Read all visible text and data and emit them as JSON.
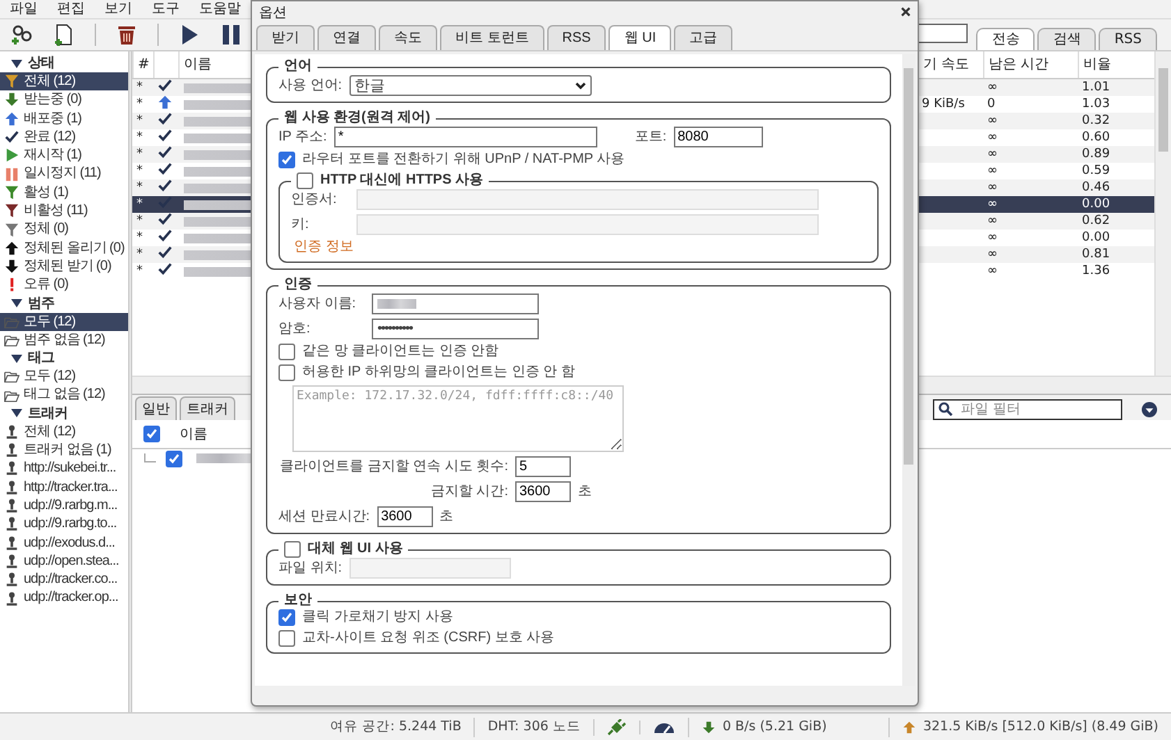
{
  "menu": [
    "파일",
    "편집",
    "보기",
    "도구",
    "도움말"
  ],
  "main_tabs": [
    {
      "label": "전송",
      "selected": true
    },
    {
      "label": "검색",
      "selected": false
    },
    {
      "label": "RSS",
      "selected": false
    }
  ],
  "sidebar": {
    "sections": [
      {
        "title": "상태",
        "expanded": true,
        "items": [
          {
            "label": "전체 (12)",
            "kind": "all",
            "selected": true
          },
          {
            "label": "받는중 (0)",
            "kind": "downloading",
            "selected": false
          },
          {
            "label": "배포중 (1)",
            "kind": "seeding",
            "selected": false
          },
          {
            "label": "완료 (12)",
            "kind": "completed",
            "selected": false
          },
          {
            "label": "재시작 (1)",
            "kind": "resumed",
            "selected": false
          },
          {
            "label": "일시정지 (11)",
            "kind": "paused",
            "selected": false
          },
          {
            "label": "활성 (1)",
            "kind": "active",
            "selected": false
          },
          {
            "label": "비활성 (11)",
            "kind": "inactive",
            "selected": false
          },
          {
            "label": "정체 (0)",
            "kind": "stalled",
            "selected": false
          },
          {
            "label": "정체된 올리기 (0)",
            "kind": "stalled_up",
            "selected": false
          },
          {
            "label": "정체된 받기 (0)",
            "kind": "stalled_down",
            "selected": false
          },
          {
            "label": "오류 (0)",
            "kind": "errored",
            "selected": false
          }
        ]
      },
      {
        "title": "범주",
        "expanded": true,
        "items": [
          {
            "label": "모두 (12)",
            "kind": "folder",
            "selected": true
          },
          {
            "label": "범주 없음 (12)",
            "kind": "folder",
            "selected": false
          }
        ]
      },
      {
        "title": "태그",
        "expanded": true,
        "items": [
          {
            "label": "모두 (12)",
            "kind": "folder",
            "selected": false
          },
          {
            "label": "태그 없음 (12)",
            "kind": "folder",
            "selected": false
          }
        ]
      },
      {
        "title": "트래커",
        "expanded": true,
        "items": [
          {
            "label": "전체 (12)",
            "kind": "tracker",
            "selected": false
          },
          {
            "label": "트래커 없음 (1)",
            "kind": "tracker",
            "selected": false
          },
          {
            "label": "http://sukebei.tr...",
            "kind": "tracker",
            "selected": false
          },
          {
            "label": "http://tracker.tra...",
            "kind": "tracker",
            "selected": false
          },
          {
            "label": "udp://9.rarbg.m...",
            "kind": "tracker",
            "selected": false
          },
          {
            "label": "udp://9.rarbg.to...",
            "kind": "tracker",
            "selected": false
          },
          {
            "label": "udp://exodus.d...",
            "kind": "tracker",
            "selected": false
          },
          {
            "label": "udp://open.stea...",
            "kind": "tracker",
            "selected": false
          },
          {
            "label": "udp://tracker.co...",
            "kind": "tracker",
            "selected": false
          },
          {
            "label": "udp://tracker.op...",
            "kind": "tracker",
            "selected": false
          }
        ]
      }
    ]
  },
  "torrents": {
    "columns": [
      "#",
      "이름",
      "기 속도",
      "남은 시간",
      "비율"
    ],
    "rows": [
      {
        "num": "*",
        "kind": "completed",
        "eta": "∞",
        "ratio": "1.01",
        "selected": false
      },
      {
        "num": "*",
        "kind": "seeding",
        "speed": "9 KiB/s",
        "eta": "0",
        "ratio": "1.03",
        "selected": false
      },
      {
        "num": "*",
        "kind": "completed",
        "eta": "∞",
        "ratio": "0.32",
        "selected": false
      },
      {
        "num": "*",
        "kind": "completed",
        "eta": "∞",
        "ratio": "0.60",
        "selected": false
      },
      {
        "num": "*",
        "kind": "completed",
        "eta": "∞",
        "ratio": "0.89",
        "selected": false
      },
      {
        "num": "*",
        "kind": "completed",
        "eta": "∞",
        "ratio": "0.59",
        "selected": false
      },
      {
        "num": "*",
        "kind": "completed",
        "eta": "∞",
        "ratio": "0.46",
        "selected": false
      },
      {
        "num": "*",
        "kind": "completed",
        "eta": "∞",
        "ratio": "0.00",
        "selected": true
      },
      {
        "num": "*",
        "kind": "completed",
        "eta": "∞",
        "ratio": "0.62",
        "selected": false
      },
      {
        "num": "*",
        "kind": "completed",
        "eta": "∞",
        "ratio": "0.00",
        "selected": false
      },
      {
        "num": "*",
        "kind": "completed",
        "eta": "∞",
        "ratio": "0.81",
        "selected": false
      },
      {
        "num": "*",
        "kind": "completed",
        "eta": "∞",
        "ratio": "1.36",
        "selected": false
      }
    ]
  },
  "details": {
    "tabs": [
      {
        "label": "일반",
        "selected": false
      },
      {
        "label": "트래커",
        "selected": false
      }
    ],
    "filter_placeholder": "파일 필터",
    "files": {
      "column": "이름",
      "header_checked": true,
      "rows": [
        {
          "checked": true
        }
      ]
    }
  },
  "status_bar": {
    "free_space": "여유 공간: 5.244 TiB",
    "dht": "DHT: 306 노드",
    "download": "0 B/s (5.21 GiB)",
    "upload": "321.5 KiB/s [512.0 KiB/s] (8.49 GiB)"
  },
  "dialog": {
    "title": "옵션",
    "tabs": [
      {
        "label": "받기",
        "selected": false
      },
      {
        "label": "연결",
        "selected": false
      },
      {
        "label": "속도",
        "selected": false
      },
      {
        "label": "비트 토런트",
        "selected": false
      },
      {
        "label": "RSS",
        "selected": false
      },
      {
        "label": "웹 UI",
        "selected": true
      },
      {
        "label": "고급",
        "selected": false
      }
    ],
    "language": {
      "title": "언어",
      "label": "사용 언어:",
      "value": "한글"
    },
    "web_ui": {
      "title": "웹 사용 환경(원격 제어)",
      "ip_label": "IP 주소:",
      "ip_value": "*",
      "port_label": "포트:",
      "port_value": "8080",
      "upnp": {
        "label": "라우터 포트를 전환하기 위해 UPnP / NAT-PMP 사용",
        "checked": true
      },
      "https": {
        "label": "HTTP 대신에 HTTPS 사용",
        "checked": false,
        "cert_label": "인증서:",
        "key_label": "키:",
        "link": "인증 정보"
      }
    },
    "auth": {
      "title": "인증",
      "username_label": "사용자 이름:",
      "password_label": "암호:",
      "password_value": "••••••••••",
      "options": [
        {
          "label": "같은 망 클라이언트는 인증 안함",
          "checked": false
        },
        {
          "label": "허용한 IP 하위망의 클라이언트는 인증 안 함",
          "checked": false
        }
      ],
      "subnets_placeholder": "Example: 172.17.32.0/24, fdff:ffff:c8::/40",
      "ban_attempts_label": "클라이언트를 금지할 연속 시도 횟수:",
      "ban_attempts_value": "5",
      "ban_time_label": "금지할 시간:",
      "ban_time_value": "3600",
      "ban_time_unit": "초",
      "session_label": "세션 만료시간:",
      "session_value": "3600",
      "session_unit": "초"
    },
    "alt_ui": {
      "label": "대체 웹 UI 사용",
      "checked": false,
      "path_label": "파일 위치:"
    },
    "security": {
      "title": "보안",
      "options": [
        {
          "label": "클릭 가로채기 방지 사용",
          "checked": true
        },
        {
          "label": "교차-사이트 요청 위조 (CSRF) 보호 사용",
          "checked": false
        }
      ]
    }
  }
}
